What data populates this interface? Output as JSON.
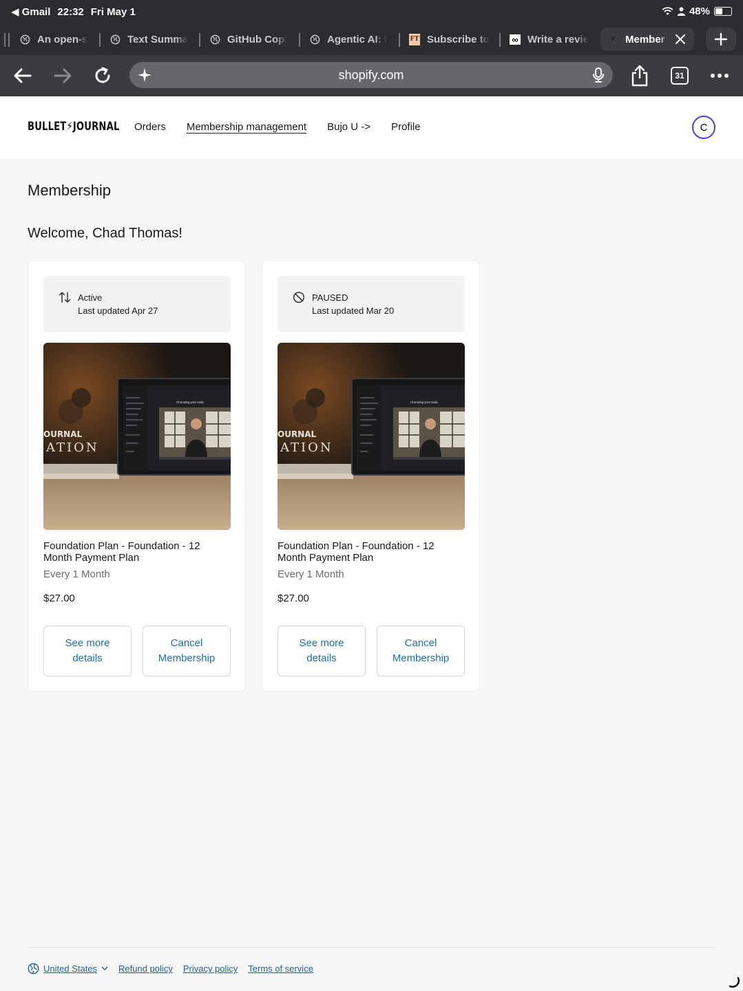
{
  "status_bar": {
    "back_app": "Gmail",
    "time": "22:32",
    "date": "Fri May 1",
    "battery": "48%",
    "battery_level": 0.48
  },
  "tabs": [
    {
      "title": "An open-s",
      "icon": "globe-icon"
    },
    {
      "title": "Text Summa",
      "icon": "globe-icon"
    },
    {
      "title": "GitHub Copi",
      "icon": "globe-icon"
    },
    {
      "title": "Agentic AI: I",
      "icon": "globe-icon"
    },
    {
      "title": "Subscribe to",
      "icon": "ft-icon"
    },
    {
      "title": "Write a revie",
      "icon": "infinity-icon"
    },
    {
      "title": "Member",
      "icon": "bolt-icon",
      "active": true
    }
  ],
  "toolbar": {
    "url": "shopify.com",
    "tab_count": "31"
  },
  "site": {
    "logo": "BULLET⚡JOURNAL",
    "nav": [
      "Orders",
      "Membership management",
      "Bujo U ->",
      "Profile"
    ],
    "current_nav": "Membership management",
    "avatar_initial": "C",
    "accent_color": "#4b3fc4"
  },
  "page": {
    "title": "Membership",
    "welcome": "Welcome, Chad Thomas!"
  },
  "memberships": [
    {
      "status": "Active",
      "status_icon": "swap-arrows-icon",
      "updated": "Last updated Apr 27",
      "plan": "Foundation Plan - Foundation - 12 Month Payment Plan",
      "frequency": "Every 1 Month",
      "price": "$27.00",
      "details_label": "See more details",
      "cancel_label": "Cancel Membership",
      "image_text_top": "OURNAL",
      "image_text_bottom": "ATION",
      "screen_heading": "Choosing your tools"
    },
    {
      "status": "PAUSED",
      "status_icon": "prohibited-icon",
      "updated": "Last updated Mar 20",
      "plan": "Foundation Plan - Foundation - 12 Month Payment Plan",
      "frequency": "Every 1 Month",
      "price": "$27.00",
      "details_label": "See more details",
      "cancel_label": "Cancel Membership",
      "image_text_top": "OURNAL",
      "image_text_bottom": "ATION",
      "screen_heading": "Choosing your tools"
    }
  ],
  "footer": {
    "region": "United States",
    "links": [
      "Refund policy",
      "Privacy policy",
      "Terms of service"
    ],
    "link_color": "#1f5f95"
  }
}
